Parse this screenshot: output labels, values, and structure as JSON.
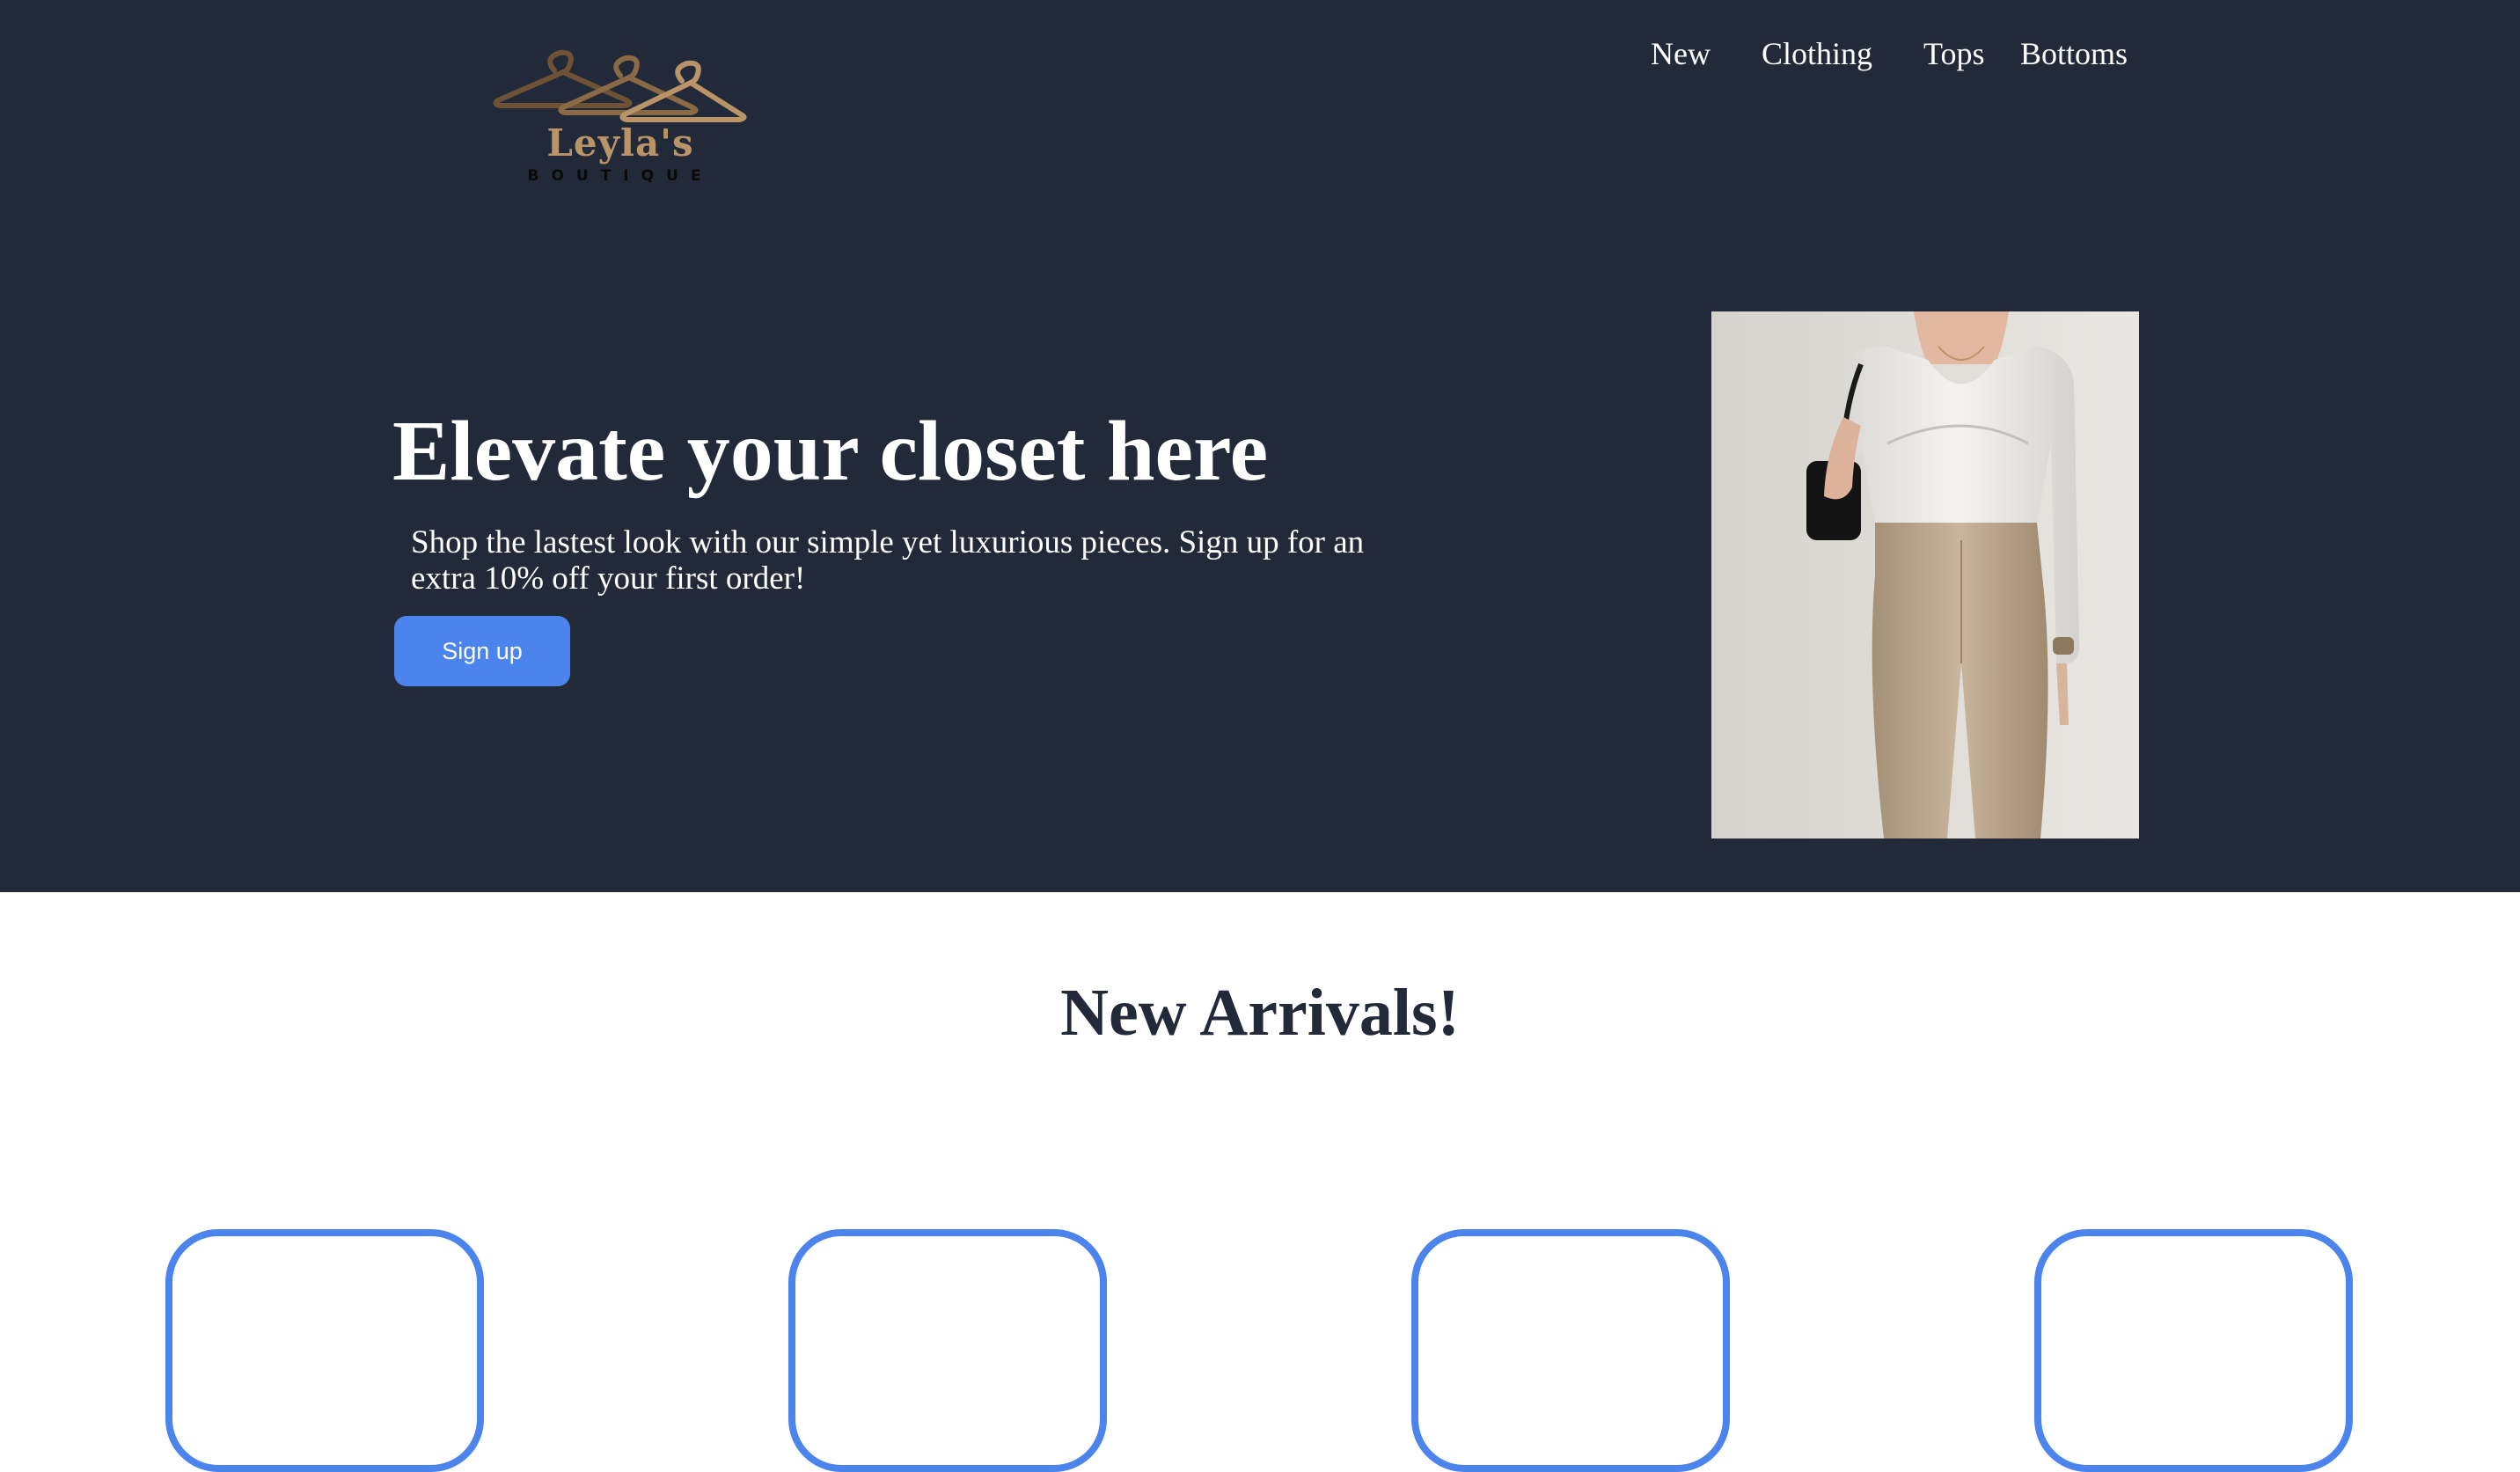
{
  "brand": {
    "name": "Leyla's",
    "tagline": "BOUTIQUE",
    "colors": {
      "gold": "#b89468",
      "dark_gold": "#8a6a45",
      "black": "#0a0a0a"
    }
  },
  "nav": {
    "items": [
      {
        "label": "New"
      },
      {
        "label": "Clothing"
      },
      {
        "label": "Tops"
      },
      {
        "label": "Bottoms"
      }
    ]
  },
  "hero": {
    "title": "Elevate your closet here",
    "subtitle": "Shop the lastest look with our simple yet luxurious pieces. Sign up for an extra 10% off your first order!",
    "cta_label": "Sign up",
    "image_subject": "model wearing white ribbed long-sleeve top, beige fitted trousers, black shoulder bag"
  },
  "arrivals": {
    "title": "New Arrivals!",
    "cards": [
      {},
      {},
      {},
      {}
    ]
  },
  "colors": {
    "hero_bg": "#222938",
    "accent": "#4a84ec",
    "text_light": "#ffffff",
    "text_dark": "#222938",
    "page_bg": "#ffffff"
  }
}
